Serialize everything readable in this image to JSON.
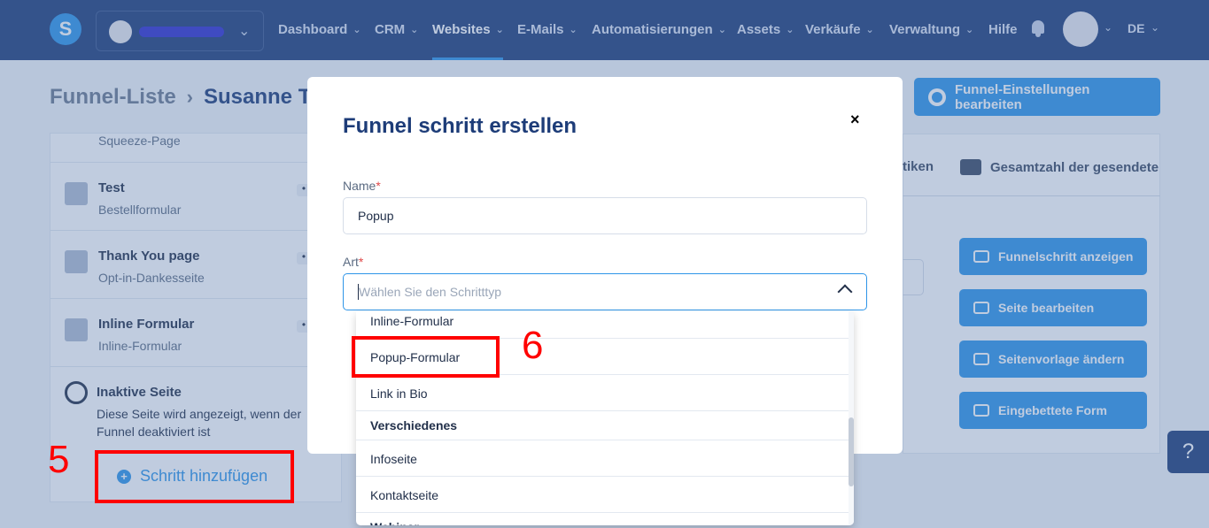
{
  "nav": {
    "items": [
      {
        "label": "Dashboard"
      },
      {
        "label": "CRM"
      },
      {
        "label": "Websites"
      },
      {
        "label": "E-Mails"
      },
      {
        "label": "Automatisierungen"
      },
      {
        "label": "Assets"
      },
      {
        "label": "Verkäufe"
      },
      {
        "label": "Verwaltung"
      },
      {
        "label": "Hilfe"
      }
    ],
    "active": "Websites",
    "lang": "DE"
  },
  "breadcrumb": {
    "root": "Funnel-Liste",
    "current": "Susanne Te"
  },
  "settings_button": "Funnel-Einstellungen bearbeiten",
  "steps": [
    {
      "subtitle": "Squeeze-Page"
    },
    {
      "title": "Test",
      "subtitle": "Bestellformular"
    },
    {
      "title": "Thank You page",
      "subtitle": "Opt-in-Dankesseite"
    },
    {
      "title": "Inline Formular",
      "subtitle": "Inline-Formular"
    }
  ],
  "inactive": {
    "title": "Inaktive Seite",
    "description": "Diese Seite wird angezeigt, wenn der Funnel deaktiviert ist"
  },
  "add_step": "Schritt hinzufügen",
  "right_panel": {
    "tab_stats": "tiken",
    "tab_total": "Gesamtzahl der gesendete",
    "actions": [
      "Funnelschritt anzeigen",
      "Seite bearbeiten",
      "Seitenvorlage ändern",
      "Eingebettete Form"
    ]
  },
  "help": "?",
  "modal": {
    "title": "Funnel schritt erstellen",
    "close": "×",
    "name_label": "Name",
    "name_value": "Popup",
    "type_label": "Art",
    "type_placeholder": "Wählen Sie den Schritttyp",
    "required_mark": "*"
  },
  "dropdown": {
    "options": [
      {
        "label": "Inline-Formular"
      },
      {
        "label": "Popup-Formular"
      },
      {
        "label": "Link in Bio"
      },
      {
        "label": "Verschiedenes",
        "group": true
      },
      {
        "label": "Infoseite"
      },
      {
        "label": "Kontaktseite"
      },
      {
        "label": "Webinar",
        "group": true
      }
    ]
  },
  "annotations": {
    "step5": "5",
    "step6": "6",
    "color": "#ff0000"
  }
}
